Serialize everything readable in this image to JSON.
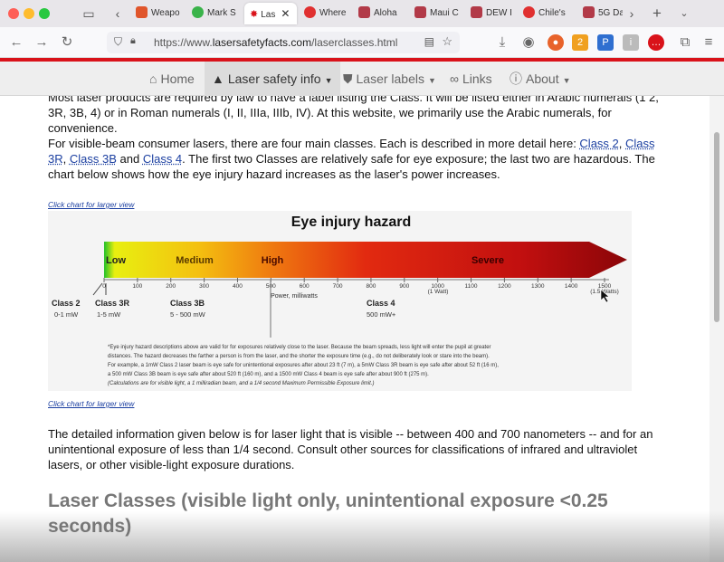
{
  "tabs": [
    {
      "label": "Weapo",
      "color": "#e0552b"
    },
    {
      "label": "Mark S",
      "color": "#3ab34a"
    },
    {
      "label": "Las",
      "color": "#ffffff",
      "active": true
    },
    {
      "label": "Where",
      "color": "#e03030"
    },
    {
      "label": "Aloha",
      "color": "#b23a48"
    },
    {
      "label": "Maui C",
      "color": "#b23a48"
    },
    {
      "label": "DEW I",
      "color": "#b23a48"
    },
    {
      "label": "Chile's",
      "color": "#e03030"
    },
    {
      "label": "5G Da",
      "color": "#b23a48"
    }
  ],
  "browser": {
    "url_prefix": "https://www.",
    "url_domain": "lasersafetyfacts.com",
    "url_path": "/laserclasses.html",
    "ext_badge": "2"
  },
  "sitenav": {
    "home": "Home",
    "safety": "Laser safety info",
    "labels": "Laser labels",
    "links": "Links",
    "about": "About"
  },
  "content": {
    "p1": "Most laser products are required by law to have a label listing the Class. It will be listed either in Arabic numerals (1 2, 3R, 3B, 4) or in Roman numerals (I, II, IIIa, IIIb, IV). At this website, we primarily use the Arabic numerals, for convenience.",
    "p2_before": "For visible-beam consumer lasers, there are four main classes. Each is described in more detail here: ",
    "link_class2": "Class 2",
    "link_class3r": "Class 3R",
    "link_class3b": "Class 3B",
    "link_and": " and ",
    "link_class4": "Class 4",
    "p2_after": ". The first two Classes are relatively safe for eye exposure; the last two are hazardous. The chart below shows how the eye injury hazard increases as the laser's power increases.",
    "chart_link_top": "Click chart for larger view",
    "chart_link_bottom": "Click chart for larger view",
    "p3": "The detailed information given below is for laser light that is visible -- between 400 and 700 nanometers -- and for an unintentional exposure of less than 1/4 second. Consult other sources for classifications of infrared and ultraviolet lasers, or other visible-light exposure durations.",
    "heading": "Laser Classes (visible light only, unintentional exposure <0.25 seconds)"
  },
  "chart": {
    "title": "Eye injury hazard",
    "zones": [
      "Low",
      "Medium",
      "High",
      "Severe"
    ],
    "axis_label": "Power, milliwatts",
    "ticks": [
      "0",
      "100",
      "200",
      "300",
      "400",
      "500",
      "600",
      "700",
      "800",
      "900",
      "1000",
      "1100",
      "1200",
      "1300",
      "1400",
      "1500"
    ],
    "tick_1000_note": "(1 Watt)",
    "tick_1500_note": "(1.5 Watts)",
    "class2_name": "Class 2",
    "class2_range": "0-1 mW",
    "class3r_name": "Class 3R",
    "class3r_range": "1-5 mW",
    "class3b_name": "Class 3B",
    "class3b_range": "5 - 500 mW",
    "class4_name": "Class 4",
    "class4_range": "500 mW+",
    "note1": "*Eye injury hazard descriptions above are valid for for exposures relatively close to the laser. Because the beam spreads, less light will enter the pupil at greater",
    "note2": "distances. The hazard decreases the farther a person is from the laser, and the shorter the exposure time (e.g., do not deliberately look or stare into the beam).",
    "note3": "For example, a 1mW Class 2 laser beam is eye safe for unintentional exposures after about 23 ft (7 m), a 5mW Class 3R beam is eye safe after about 52 ft (16 m),",
    "note4": "a 500 mW Class 3B beam is eye safe after about 520 ft (160 m), and a 1500 mW Class 4 beam is eye safe after about 900 ft (275 m).",
    "note5": "(Calculations are for visible light, a 1 milliradian beam, and a 1/4 second Maximum Permissible Exposure limit.)"
  }
}
